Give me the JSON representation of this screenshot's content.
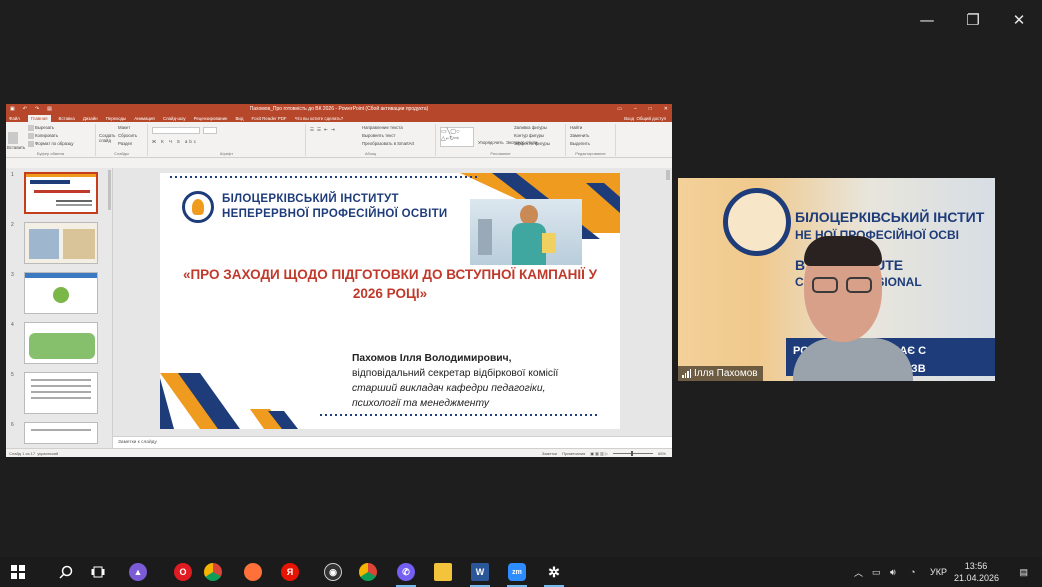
{
  "zoom_window": {
    "minimize": "—",
    "restore": "❐",
    "close": "✕"
  },
  "ppt": {
    "title": "Пахомов_Про готовність до ВК 2026 - PowerPoint (Сбой активации продукта)",
    "tabs": [
      "Файл",
      "Главная",
      "Вставка",
      "Дизайн",
      "Переходы",
      "Анимация",
      "Слайд-шоу",
      "Рецензирование",
      "Вид",
      "Foxit Reader PDF",
      "Что вы хотите сделать?"
    ],
    "login": "Вход",
    "share": "Общий доступ",
    "ribbon": {
      "groups": [
        "Буфер обмена",
        "Слайды",
        "Шрифт",
        "Абзац",
        "Рисование",
        "Редактирование"
      ],
      "clipboard": {
        "paste": "Вставить",
        "cut": "Вырезать",
        "copy": "Копировать",
        "format": "Формат по образцу"
      },
      "slides": {
        "new": "Создать слайд",
        "layout": "Макет",
        "reset": "Сбросить",
        "section": "Раздел"
      },
      "paragraph": {
        "dir": "Направление текста",
        "align": "Выровнять текст",
        "smart": "Преобразовать в SmartArt"
      },
      "drawing": {
        "arrange": "Упорядочить",
        "styles": "Экспресс-стили",
        "fill": "Заливка фигуры",
        "outline": "Контур фигуры",
        "effects": "Эффекты фигуры"
      },
      "editing": {
        "find": "Найти",
        "replace": "Заменить",
        "select": "Выделить"
      }
    },
    "thumb_numbers": [
      "1",
      "2",
      "3",
      "4",
      "5",
      "6"
    ],
    "slide": {
      "inst_line1": "БІЛОЦЕРКІВСЬКИЙ ІНСТИТУТ",
      "inst_line2": "НЕПЕРЕРВНОЇ ПРОФЕСІЙНОЇ ОСВІТИ",
      "heading": "«ПРО ЗАХОДИ ЩОДО ПІДГОТОВКИ ДО ВСТУПНОЇ КАМПАНІЇ У 2026 РОЦІ»",
      "person_name": "Пахомов Ілля Володимирович,",
      "person_role1": "відповідальний секретар відбіркової комісії",
      "person_role2": "старший викладач кафедри педагогіки,",
      "person_role3": "психології та менеджменту"
    },
    "notes_placeholder": "Заметки к слайду",
    "status_left": "Слайд 1 из 17",
    "status_lang": "украинский",
    "status_notes": "Заметки",
    "status_comments": "Примечания",
    "zoom": "65%"
  },
  "video": {
    "line1": "БІЛОЦЕРКІВСЬКИЙ ІНСТИТ",
    "line2": "НЕ   НОЇ ПРОФЕСІЙНОЇ ОСВІ",
    "line3": "B        VA INSTITUTE",
    "line4": "C      US PROFESSIONAL",
    "line5": "РОЛ           ОНАЛІВ, ЩО ДАЄ С",
    "line6": "   МУ РОЗВ",
    "participant": "Ілля Пахомов"
  },
  "taskbar": {
    "lang": "УКР",
    "time": "13:56",
    "date": "21.04.2026"
  },
  "colors": {
    "ppt_red": "#b7472a",
    "brand_blue": "#1e3c7a",
    "brand_orange": "#ef9b20",
    "heading_red": "#c0392b"
  }
}
